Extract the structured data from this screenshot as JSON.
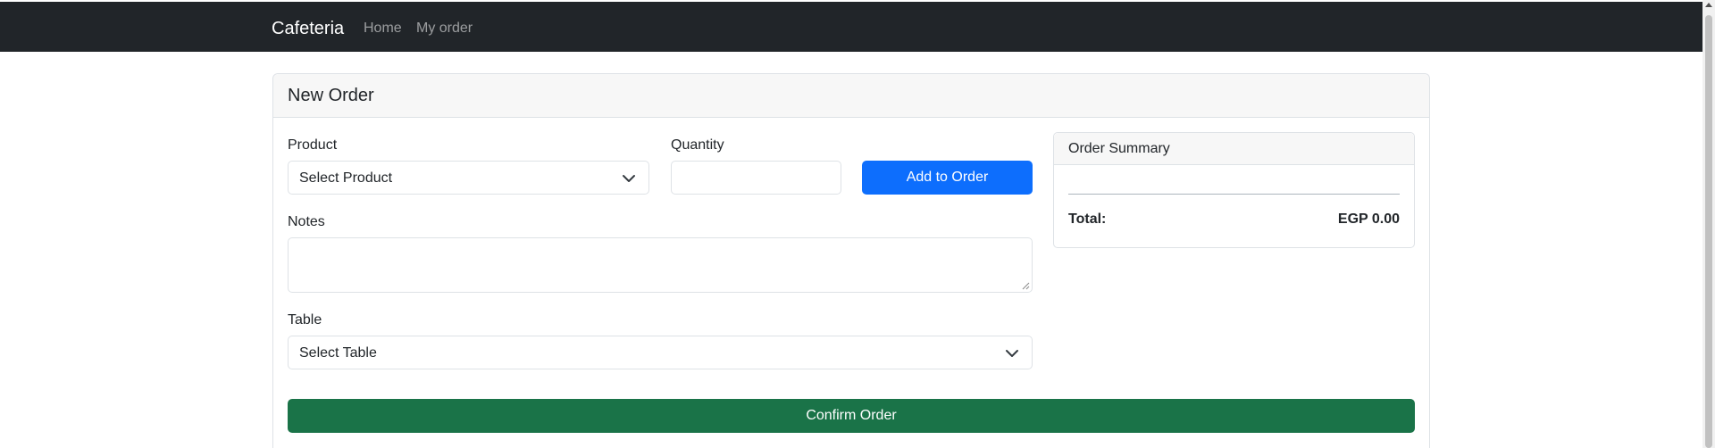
{
  "navbar": {
    "brand": "Cafeteria",
    "links": [
      "Home",
      "My order"
    ]
  },
  "card": {
    "title": "New Order"
  },
  "form": {
    "product_label": "Product",
    "product_selected": "Select Product",
    "quantity_label": "Quantity",
    "quantity_value": "",
    "add_button": "Add to Order",
    "notes_label": "Notes",
    "notes_value": "",
    "table_label": "Table",
    "table_selected": "Select Table",
    "confirm_button": "Confirm Order"
  },
  "summary": {
    "title": "Order Summary",
    "total_label": "Total:",
    "total_value": "EGP 0.00"
  },
  "colors": {
    "navbar_bg": "#212529",
    "primary": "#0d6efd",
    "success": "#1a7348"
  },
  "icons": {
    "product_select": "chevron-down-icon",
    "table_select": "chevron-down-icon",
    "scroll_up": "triangle-up-icon"
  }
}
